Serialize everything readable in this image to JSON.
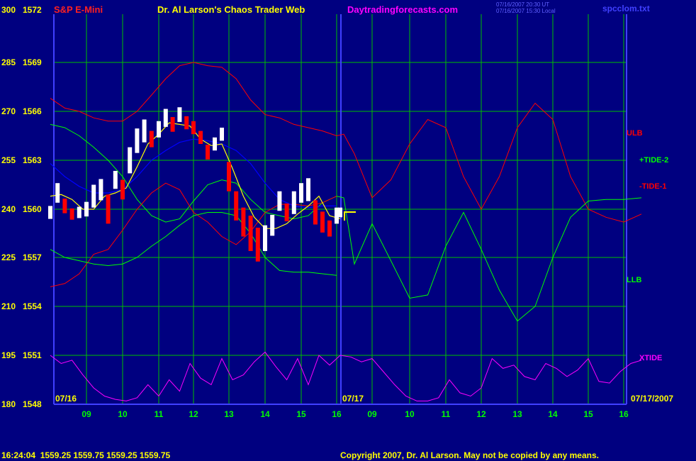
{
  "header": {
    "instrument": "S&P E-Mini",
    "title": "Dr. Al Larson's Chaos Trader Web",
    "website": "Daytradingforecasts.com",
    "timestamp_line1": "07/16/2007 20:30 UT",
    "timestamp_line2": "07/16/2007 15:30 Local",
    "filename": "spcclom.txt"
  },
  "footer": {
    "quote": "16:24:04  1559.25 1559.75 1559.25 1559.75",
    "copyright": "Copyright 2007, Dr. Al Larson. May not be copied by any means."
  },
  "colors": {
    "background": "#000080",
    "grid": "#00C000",
    "axis": "#4040FF",
    "ulb": "#FF0000",
    "tide2": "#00FF00",
    "tide1": "#FF0000",
    "llb": "#00FF00",
    "xtide": "#FF00FF",
    "price_up": "#FFFFFF",
    "price_down": "#FF0000",
    "moving_avg": "#0000FF",
    "price_ma": "#FFFF00"
  },
  "chart_data": {
    "type": "line",
    "y_axis": {
      "left_labels": [
        "300",
        "285",
        "270",
        "255",
        "240",
        "225",
        "210",
        "195",
        "180"
      ],
      "price_labels": [
        "1572",
        "1569",
        "1566",
        "1563",
        "1560",
        "1557",
        "1554",
        "1551",
        "1548"
      ]
    },
    "x_axis": {
      "hour_ticks": [
        "09",
        "10",
        "11",
        "12",
        "13",
        "14",
        "15",
        "16",
        "09",
        "10",
        "11",
        "12",
        "13",
        "14",
        "15",
        "16"
      ],
      "date_labels": [
        "07/16",
        "07/17",
        "07/17/2007"
      ]
    },
    "ylim": [
      1548,
      1572
    ],
    "grid": true,
    "series": [
      {
        "name": "ULB",
        "color": "#FF0000",
        "x": [
          8.0,
          8.4,
          8.8,
          9.2,
          9.6,
          10.0,
          10.4,
          10.8,
          11.2,
          11.6,
          12.0,
          12.4,
          12.8,
          13.2,
          13.6,
          14.0,
          14.4,
          14.8,
          15.2,
          15.6,
          16.0,
          16.2,
          16.5,
          17.0,
          17.5,
          18.0,
          18.5,
          19.0,
          19.5,
          20.0,
          20.5,
          21.0,
          21.5,
          22.0,
          22.5,
          23.0,
          23.5,
          24.0,
          24.5
        ],
        "y": [
          1566.8,
          1566.2,
          1566.0,
          1565.6,
          1565.4,
          1565.4,
          1566.0,
          1567.0,
          1568.0,
          1568.8,
          1569.0,
          1568.8,
          1568.7,
          1568.0,
          1566.7,
          1565.8,
          1565.6,
          1565.2,
          1565.0,
          1564.8,
          1564.5,
          1564.6,
          1563.4,
          1560.7,
          1561.8,
          1564.0,
          1565.5,
          1565.0,
          1562.0,
          1560.0,
          1562.0,
          1565.0,
          1566.5,
          1565.5,
          1562.0,
          1560.0,
          1559.5,
          1559.2,
          1559.7
        ]
      },
      {
        "name": "+TIDE-2",
        "color": "#00FF00",
        "x": [
          8.0,
          8.4,
          8.8,
          9.2,
          9.6,
          10.0,
          10.4,
          10.8,
          11.2,
          11.6,
          12.0,
          12.4,
          12.8,
          13.2,
          13.6,
          14.0,
          14.4,
          14.8,
          15.2,
          15.6,
          16.0,
          16.2,
          16.5,
          17.0,
          17.5,
          18.0,
          18.5,
          19.0,
          19.5,
          20.0,
          20.5,
          21.0,
          21.5,
          22.0,
          22.5,
          23.0,
          23.5,
          24.0,
          24.5
        ],
        "y": [
          1565.2,
          1565.0,
          1564.5,
          1563.8,
          1563.0,
          1562.0,
          1560.6,
          1559.6,
          1559.2,
          1559.4,
          1560.5,
          1561.5,
          1561.8,
          1561.6,
          1560.6,
          1559.8,
          1559.6,
          1559.4,
          1559.6,
          1560.4,
          1560.8,
          1560.7,
          1556.6,
          1559.1,
          1556.8,
          1554.5,
          1554.7,
          1557.7,
          1559.8,
          1557.5,
          1555.0,
          1553.1,
          1554.0,
          1557.0,
          1559.5,
          1560.5,
          1560.6,
          1560.6,
          1560.7
        ]
      },
      {
        "name": "-TIDE-1",
        "color": "#FF0000",
        "x": [
          8.0,
          8.4,
          8.8,
          9.2,
          9.6,
          10.0,
          10.4,
          10.8,
          11.2,
          11.6,
          12.0,
          12.4,
          12.8,
          13.2,
          13.6,
          14.0,
          14.4,
          14.8,
          15.2,
          15.6,
          16.0
        ],
        "y": [
          1555.2,
          1555.4,
          1556.0,
          1557.2,
          1557.5,
          1558.7,
          1560.0,
          1561.0,
          1561.6,
          1561.2,
          1559.8,
          1559.2,
          1558.3,
          1557.8,
          1558.6,
          1559.8,
          1560.3,
          1560.3,
          1560.2,
          1560.4,
          1560.8
        ]
      },
      {
        "name": "LLB",
        "color": "#00FF00",
        "x": [
          8.0,
          8.4,
          8.8,
          9.2,
          9.6,
          10.0,
          10.4,
          10.8,
          11.2,
          11.6,
          12.0,
          12.4,
          12.8,
          13.2,
          13.6,
          14.0,
          14.4,
          14.8,
          15.2,
          15.6,
          16.0
        ],
        "y": [
          1557.5,
          1557.0,
          1556.8,
          1556.6,
          1556.5,
          1556.6,
          1557.0,
          1557.7,
          1558.3,
          1559.0,
          1559.6,
          1559.8,
          1559.8,
          1559.6,
          1558.5,
          1557.0,
          1556.2,
          1556.1,
          1556.1,
          1556.0,
          1555.9
        ]
      },
      {
        "name": "XTIDE",
        "color": "#FF00FF",
        "x": [
          8.0,
          8.3,
          8.6,
          8.9,
          9.2,
          9.5,
          9.8,
          10.1,
          10.4,
          10.7,
          11.0,
          11.3,
          11.6,
          11.9,
          12.2,
          12.5,
          12.8,
          13.1,
          13.4,
          13.7,
          14.0,
          14.3,
          14.6,
          14.9,
          15.2,
          15.5,
          15.8,
          16.1,
          16.4,
          16.7,
          17.0,
          17.3,
          17.6,
          17.9,
          18.2,
          18.5,
          18.8,
          19.1,
          19.4,
          19.7,
          20.0,
          20.3,
          20.6,
          20.9,
          21.2,
          21.5,
          21.8,
          22.1,
          22.4,
          22.7,
          23.0,
          23.3,
          23.6,
          23.9,
          24.2,
          24.5
        ],
        "y": [
          1551.0,
          1550.5,
          1550.7,
          1549.8,
          1549.0,
          1548.5,
          1548.3,
          1548.2,
          1548.4,
          1549.2,
          1548.5,
          1549.5,
          1548.8,
          1550.5,
          1549.6,
          1549.2,
          1550.8,
          1549.5,
          1549.8,
          1550.6,
          1551.2,
          1550.3,
          1549.5,
          1550.8,
          1549.2,
          1551.0,
          1550.4,
          1551.0,
          1550.9,
          1550.6,
          1550.8,
          1550.0,
          1549.2,
          1548.5,
          1548.2,
          1548.2,
          1548.4,
          1549.5,
          1548.7,
          1548.5,
          1549.0,
          1550.8,
          1550.2,
          1550.4,
          1549.7,
          1549.5,
          1550.5,
          1550.2,
          1549.7,
          1550.1,
          1550.8,
          1549.4,
          1549.3,
          1550.0,
          1550.5,
          1550.7
        ]
      },
      {
        "name": "",
        "color": "#0000FF",
        "x": [
          8.0,
          8.4,
          8.8,
          9.2,
          9.6,
          10.0,
          10.4,
          10.8,
          11.2,
          11.6,
          12.0,
          12.4,
          12.8,
          13.2,
          13.6,
          14.0,
          14.4,
          14.8,
          15.2,
          15.6,
          16.0
        ],
        "y": [
          1562.8,
          1562.0,
          1561.4,
          1561.0,
          1561.0,
          1561.2,
          1562.0,
          1563.0,
          1563.6,
          1564.1,
          1564.3,
          1564.2,
          1564.0,
          1563.6,
          1562.8,
          1561.6,
          1560.6,
          1560.2,
          1560.1,
          1560.2,
          1560.2
        ]
      },
      {
        "name": "",
        "color": "#FFFF00",
        "x": [
          8.0,
          8.3,
          8.6,
          8.9,
          9.2,
          9.5,
          9.8,
          10.1,
          10.4,
          10.7,
          11.0,
          11.3,
          11.6,
          11.9,
          12.2,
          12.5,
          12.8,
          13.1,
          13.4,
          13.7,
          14.0,
          14.3,
          14.6,
          14.9,
          15.2,
          15.5,
          15.8,
          16.1
        ],
        "y": [
          1560.8,
          1560.9,
          1560.6,
          1560.0,
          1560.0,
          1560.8,
          1561.0,
          1561.3,
          1562.6,
          1564.0,
          1564.6,
          1565.3,
          1565.2,
          1565.1,
          1564.3,
          1563.9,
          1564.0,
          1562.5,
          1560.8,
          1559.5,
          1558.8,
          1558.8,
          1559.1,
          1559.7,
          1560.2,
          1560.8,
          1559.6,
          1559.4
        ]
      }
    ],
    "price_bars": {
      "x": [
        8.0,
        8.2,
        8.4,
        8.6,
        8.8,
        9.0,
        9.2,
        9.4,
        9.6,
        9.8,
        10.0,
        10.2,
        10.4,
        10.6,
        10.8,
        11.0,
        11.2,
        11.4,
        11.6,
        11.8,
        12.0,
        12.2,
        12.4,
        12.6,
        12.8,
        13.0,
        13.2,
        13.4,
        13.6,
        13.8,
        14.0,
        14.2,
        14.4,
        14.6,
        14.8,
        15.0,
        15.2,
        15.4,
        15.6,
        15.8,
        16.0,
        16.1
      ],
      "close": [
        1559.8,
        1561.0,
        1560.2,
        1559.7,
        1559.8,
        1560.0,
        1560.8,
        1561.2,
        1560.0,
        1561.8,
        1561.2,
        1563.0,
        1564.2,
        1564.8,
        1564.3,
        1564.9,
        1565.6,
        1565.2,
        1565.8,
        1565.3,
        1565.0,
        1564.4,
        1563.5,
        1564.0,
        1564.6,
        1562.0,
        1560.2,
        1559.2,
        1558.5,
        1557.8,
        1558.2,
        1559.0,
        1560.5,
        1559.8,
        1560.4,
        1561.0,
        1561.2,
        1559.8,
        1559.2,
        1558.8,
        1559.6,
        1559.8
      ],
      "range": [
        0.8,
        1.2,
        0.9,
        0.7,
        0.7,
        0.9,
        1.4,
        1.3,
        1.8,
        1.1,
        1.2,
        1.6,
        1.5,
        1.4,
        1.0,
        1.0,
        1.1,
        0.9,
        0.9,
        0.8,
        0.8,
        0.8,
        0.9,
        0.8,
        0.8,
        1.8,
        1.8,
        1.8,
        2.2,
        2.1,
        1.6,
        1.3,
        1.2,
        1.1,
        1.4,
        1.2,
        1.4,
        1.5,
        1.3,
        1.0,
        1.0,
        0.6
      ]
    }
  }
}
